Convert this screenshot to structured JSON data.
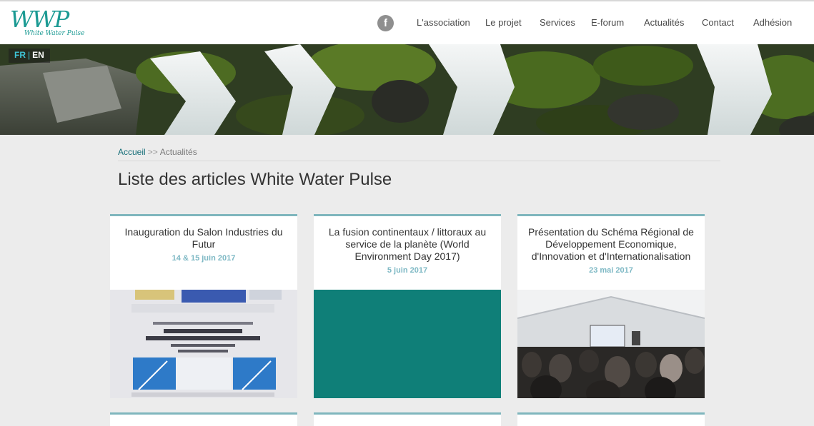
{
  "header": {
    "logo_letters": "WWP",
    "logo_tagline": "White Water Pulse",
    "facebook_icon": "facebook-icon",
    "nav": [
      {
        "label": "L'association"
      },
      {
        "label": "Le projet"
      },
      {
        "label": "Services"
      },
      {
        "label": "E-forum"
      },
      {
        "label": "Actualités"
      },
      {
        "label": "Contact"
      },
      {
        "label": "Adhésion"
      }
    ]
  },
  "lang": {
    "fr": "FR",
    "sep": "|",
    "en": "EN"
  },
  "breadcrumb": {
    "home": "Accueil",
    "separator": ">>",
    "current": "Actualités"
  },
  "page_title": "Liste des articles White Water Pulse",
  "articles": [
    {
      "title": "Inauguration du Salon Industries du Futur",
      "date": "14 & 15 juin 2017",
      "image": "event-poster-image"
    },
    {
      "title": "La fusion continentaux / littoraux au service de la planète (World Environment Day 2017)",
      "date": "5 juin 2017",
      "image": "teal-placeholder-image"
    },
    {
      "title": "Présentation du Schéma Régional de Développement Economique, d'Innovation et d'Internationalisation",
      "date": "23 mai 2017",
      "image": "conference-photo-image"
    }
  ],
  "colors": {
    "accent": "#1b9a93",
    "card_border": "#7fb6bd",
    "date": "#7db8c4",
    "teal_block": "#0f7f78",
    "background": "#ececec"
  }
}
